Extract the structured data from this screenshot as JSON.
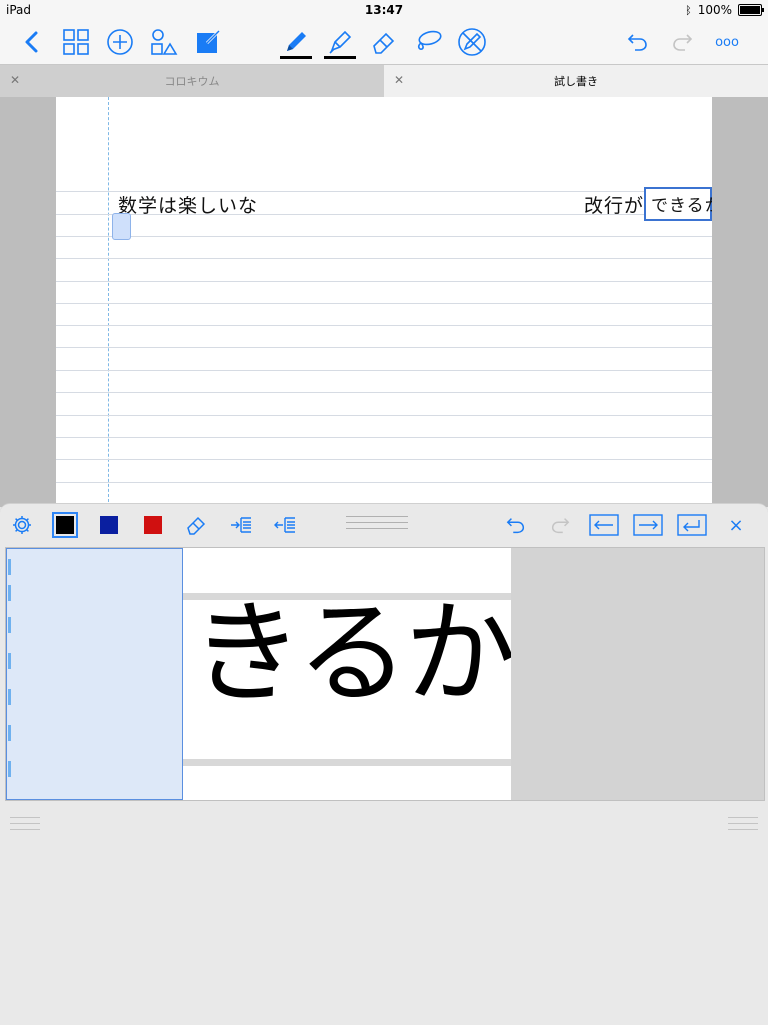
{
  "status": {
    "device": "iPad",
    "time": "13:47",
    "battery": "100%"
  },
  "toolbar": {
    "icons": [
      "chevron-left-icon",
      "grid-icon",
      "plus-circle-icon",
      "shapes-icon",
      "edit-square-icon",
      "pen-icon",
      "highlighter-icon",
      "eraser-icon",
      "lasso-icon",
      "pen-off-icon",
      "undo-icon",
      "redo-icon",
      "more-icon"
    ],
    "more_label": "ooo",
    "accent": "#1a7cf5"
  },
  "tabs": [
    {
      "label": "コロキウム",
      "active": false
    },
    {
      "label": "試し書き",
      "active": true
    }
  ],
  "document": {
    "line1_left": "数学は楽しいな",
    "line1_right_a": "改行が",
    "line1_right_b": "できるか"
  },
  "panel": {
    "colors": [
      "#000000",
      "#0a1fa0",
      "#d01010"
    ],
    "selected_color": "#000000",
    "close_label": "×",
    "handwriting": "きるか"
  }
}
